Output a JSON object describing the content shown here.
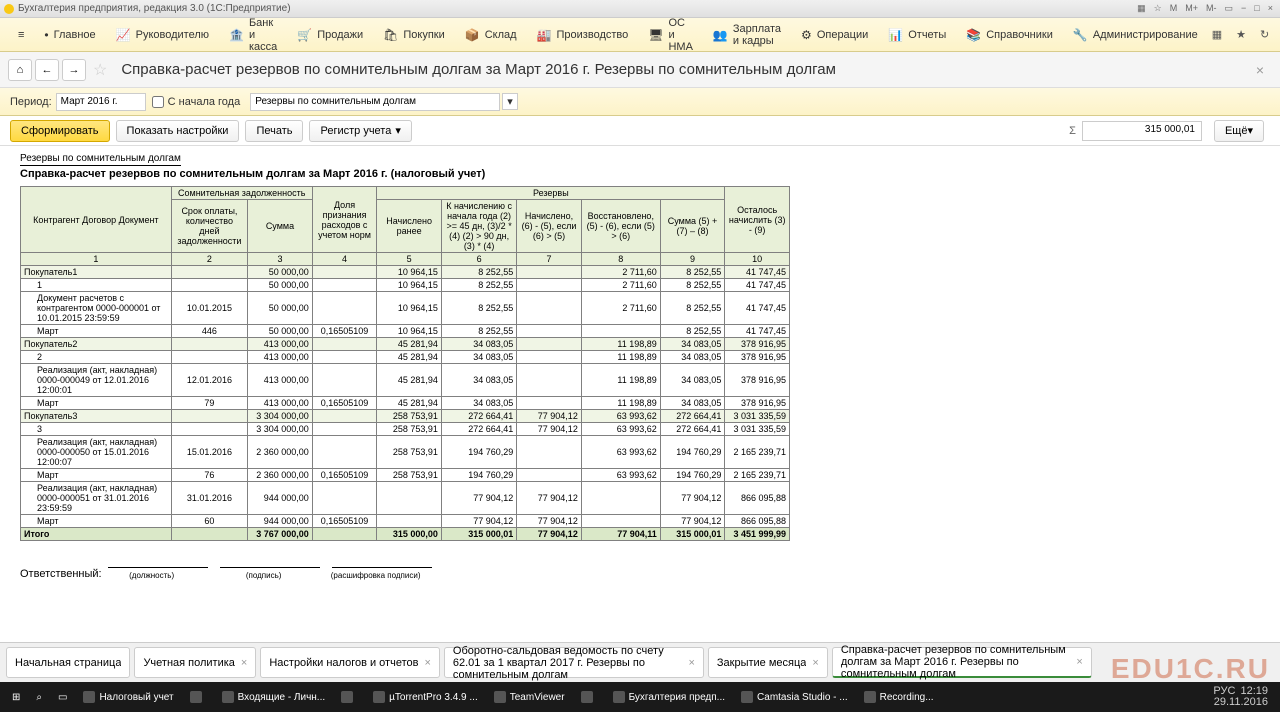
{
  "window": {
    "title": "Бухгалтерия предприятия, редакция 3.0  (1С:Предприятие)"
  },
  "menu": [
    "Главное",
    "Руководителю",
    "Банк и касса",
    "Продажи",
    "Покупки",
    "Склад",
    "Производство",
    "ОС и НМА",
    "Зарплата и кадры",
    "Операции",
    "Отчеты",
    "Справочники",
    "Администрирование"
  ],
  "page_title": "Справка-расчет резервов по сомнительным долгам за Март 2016 г. Резервы по сомнительным долгам",
  "filter": {
    "period_lbl": "Период:",
    "period": "Март 2016 г.",
    "since_start": "С начала года",
    "dropdown": "Резервы по сомнительным долгам"
  },
  "actions": {
    "form": "Сформировать",
    "settings": "Показать настройки",
    "print": "Печать",
    "register": "Регистр учета",
    "sum": "315 000,01",
    "more": "Ещё"
  },
  "report": {
    "top": "Резервы по сомнительным долгам",
    "title": "Справка-расчет резервов по сомнительным долгам за Март 2016 г. (налоговый учет)"
  },
  "headers": {
    "col1": "Контрагент\nДоговор\nДокумент",
    "g1": "Сомнительная задолженность",
    "col2": "Срок оплаты, количество дней задолженности",
    "col3": "Сумма",
    "col4": "Доля признания расходов с учетом норм",
    "g2": "Резервы",
    "col5": "Начислено ранее",
    "col6": "К начислению с начала года\n(2) >= 45 дн, (3)/2 * (4)\n(2) > 90 дн, (3) * (4)",
    "col7": "Начислено,\n(6) - (5),\nесли (6) > (5)",
    "col8": "Восстановлено,\n(5) - (6),\nесли (5) > (6)",
    "col9": "Сумма\n(5) + (7) – (8)",
    "col10": "Осталось начислить\n(3) - (9)"
  },
  "rows": [
    {
      "type": "num",
      "c": [
        "1",
        "2",
        "3",
        "4",
        "5",
        "6",
        "7",
        "8",
        "9",
        "10"
      ]
    },
    {
      "type": "group",
      "c": [
        "Покупатель1",
        "",
        "50 000,00",
        "",
        "10 964,15",
        "8 252,55",
        "",
        "2 711,60",
        "8 252,55",
        "41 747,45"
      ]
    },
    {
      "type": "sub",
      "c": [
        "1",
        "",
        "50 000,00",
        "",
        "10 964,15",
        "8 252,55",
        "",
        "2 711,60",
        "8 252,55",
        "41 747,45"
      ]
    },
    {
      "type": "doc",
      "c": [
        "Документ расчетов с контрагентом 0000-000001 от 10.01.2015 23:59:59",
        "10.01.2015",
        "50 000,00",
        "",
        "10 964,15",
        "8 252,55",
        "",
        "2 711,60",
        "8 252,55",
        "41 747,45"
      ]
    },
    {
      "type": "month",
      "c": [
        "Март",
        "446",
        "50 000,00",
        "0,16505109",
        "10 964,15",
        "8 252,55",
        "",
        "",
        "8 252,55",
        "41 747,45"
      ]
    },
    {
      "type": "group",
      "c": [
        "Покупатель2",
        "",
        "413 000,00",
        "",
        "45 281,94",
        "34 083,05",
        "",
        "11 198,89",
        "34 083,05",
        "378 916,95"
      ]
    },
    {
      "type": "sub",
      "c": [
        "2",
        "",
        "413 000,00",
        "",
        "45 281,94",
        "34 083,05",
        "",
        "11 198,89",
        "34 083,05",
        "378 916,95"
      ]
    },
    {
      "type": "doc",
      "c": [
        "Реализация (акт, накладная) 0000-000049 от 12.01.2016 12:00:01",
        "12.01.2016",
        "413 000,00",
        "",
        "45 281,94",
        "34 083,05",
        "",
        "11 198,89",
        "34 083,05",
        "378 916,95"
      ]
    },
    {
      "type": "month",
      "c": [
        "Март",
        "79",
        "413 000,00",
        "0,16505109",
        "45 281,94",
        "34 083,05",
        "",
        "11 198,89",
        "34 083,05",
        "378 916,95"
      ]
    },
    {
      "type": "group",
      "c": [
        "Покупатель3",
        "",
        "3 304 000,00",
        "",
        "258 753,91",
        "272 664,41",
        "77 904,12",
        "63 993,62",
        "272 664,41",
        "3 031 335,59"
      ]
    },
    {
      "type": "sub",
      "c": [
        "3",
        "",
        "3 304 000,00",
        "",
        "258 753,91",
        "272 664,41",
        "77 904,12",
        "63 993,62",
        "272 664,41",
        "3 031 335,59"
      ]
    },
    {
      "type": "doc",
      "c": [
        "Реализация (акт, накладная) 0000-000050 от 15.01.2016 12:00:07",
        "15.01.2016",
        "2 360 000,00",
        "",
        "258 753,91",
        "194 760,29",
        "",
        "63 993,62",
        "194 760,29",
        "2 165 239,71"
      ]
    },
    {
      "type": "month",
      "c": [
        "Март",
        "76",
        "2 360 000,00",
        "0,16505109",
        "258 753,91",
        "194 760,29",
        "",
        "63 993,62",
        "194 760,29",
        "2 165 239,71"
      ]
    },
    {
      "type": "doc",
      "c": [
        "Реализация (акт, накладная) 0000-000051 от 31.01.2016 23:59:59",
        "31.01.2016",
        "944 000,00",
        "",
        "",
        "77 904,12",
        "77 904,12",
        "",
        "77 904,12",
        "866 095,88"
      ]
    },
    {
      "type": "month",
      "c": [
        "Март",
        "60",
        "944 000,00",
        "0,16505109",
        "",
        "77 904,12",
        "77 904,12",
        "",
        "77 904,12",
        "866 095,88"
      ]
    },
    {
      "type": "total",
      "c": [
        "Итого",
        "",
        "3 767 000,00",
        "",
        "315 000,00",
        "315 000,01",
        "77 904,12",
        "77 904,11",
        "315 000,01",
        "3 451 999,99"
      ]
    }
  ],
  "sig": {
    "resp": "Ответственный:",
    "post": "(должность)",
    "sign": "(подпись)",
    "decode": "(расшифровка подписи)"
  },
  "tabs_bottom": [
    "Начальная страница",
    "Учетная политика",
    "Настройки налогов и отчетов",
    "Оборотно-сальдовая ведомость по счету 62.01 за 1 квартал 2017 г. Резервы по сомнительным долгам",
    "Закрытие месяца",
    "Справка-расчет резервов по сомнительным долгам за Март 2016 г. Резервы по сомнительным долгам"
  ],
  "taskbar": [
    "Налоговый учет",
    "",
    "Входящие - Личн...",
    "",
    "µTorrentPro 3.4.9 ...",
    "TeamViewer",
    "",
    "Бухгалтерия предп...",
    "Camtasia Studio - ...",
    "Recording..."
  ],
  "clock": {
    "time": "12:19",
    "date": "29.11.2016",
    "lang": "РУС"
  }
}
